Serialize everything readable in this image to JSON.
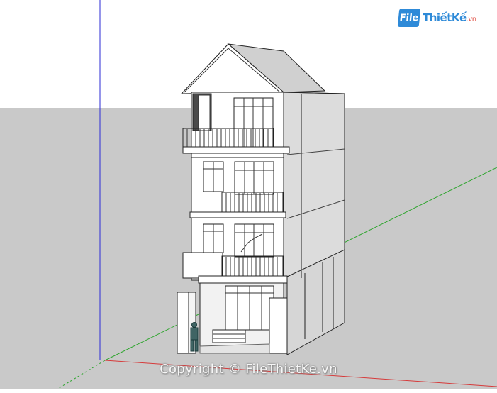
{
  "app": {
    "type": "3d-modeling-viewport",
    "background_sky": "#ffffff",
    "background_ground": "#c9c9c9",
    "axis_colors": {
      "blue": "#2b2bd6",
      "green": "#2fa52f",
      "red": "#d63a3a"
    }
  },
  "model": {
    "subject": "townhouse",
    "floors": 4,
    "roof": "gable"
  },
  "brand": {
    "mark": "File",
    "name": "ThiếtKế",
    "suffix": ".vn",
    "color": "#2e8ad8",
    "accent": "#e0463a"
  },
  "watermark": {
    "text": "Copyright © FileThietKe.vn"
  }
}
